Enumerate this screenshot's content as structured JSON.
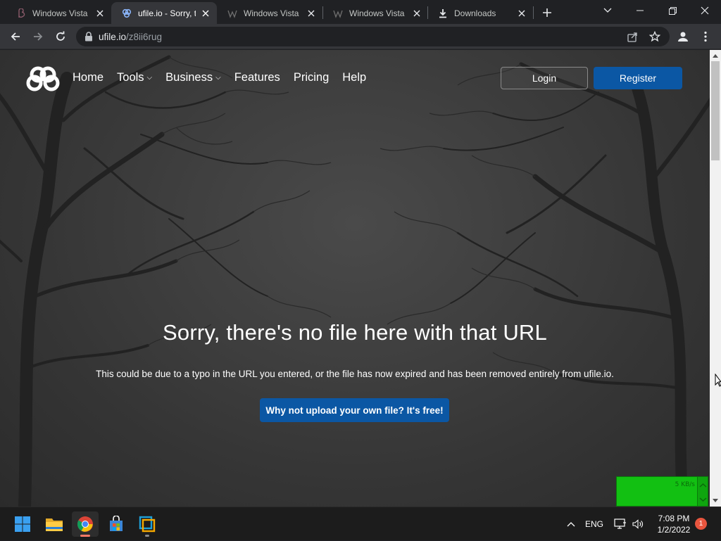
{
  "browser": {
    "tabs": [
      {
        "title": "Windows Vista",
        "favicon": "beta-icon",
        "active": false
      },
      {
        "title": "ufile.io - Sorry, t",
        "favicon": "ufile-icon",
        "active": true
      },
      {
        "title": "Windows Vista (",
        "favicon": "wordpress-icon",
        "active": false
      },
      {
        "title": "Windows Vista",
        "favicon": "wordpress-icon",
        "active": false
      },
      {
        "title": "Downloads",
        "favicon": "download-icon",
        "active": false
      }
    ],
    "address": {
      "host": "ufile.io",
      "path": "/z8ii6rug"
    }
  },
  "site": {
    "nav": [
      {
        "label": "Home",
        "has_dropdown": false
      },
      {
        "label": "Tools",
        "has_dropdown": true
      },
      {
        "label": "Business",
        "has_dropdown": true
      },
      {
        "label": "Features",
        "has_dropdown": false
      },
      {
        "label": "Pricing",
        "has_dropdown": false
      },
      {
        "label": "Help",
        "has_dropdown": false
      }
    ],
    "login_label": "Login",
    "register_label": "Register",
    "hero": {
      "title": "Sorry, there's no file here with that URL",
      "subtitle": "This could be due to a typo in the URL you entered, or the file has now expired and has been removed entirely from ufile.io.",
      "cta_label": "Why not upload your own file? It's free!"
    },
    "colors": {
      "accent": "#0b57a4"
    }
  },
  "netmeter": {
    "label": "5 KB/s"
  },
  "taskbar": {
    "apps": [
      "start-icon",
      "file-explorer-icon",
      "chrome-icon",
      "store-icon",
      "vmware-icon"
    ],
    "language": "ENG",
    "time": "7:08 PM",
    "date": "1/2/2022",
    "notification_count": "1"
  }
}
